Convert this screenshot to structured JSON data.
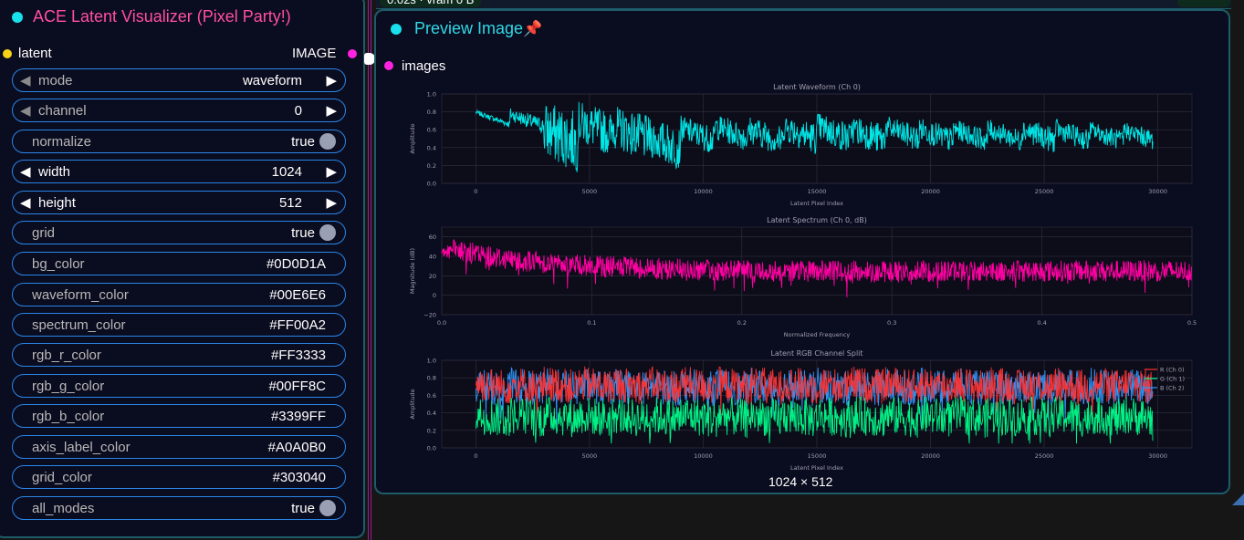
{
  "left_node": {
    "title": "ACE Latent Visualizer (Pixel Party!)",
    "input_slot": "latent",
    "output_slot": "IMAGE",
    "widgets": [
      {
        "name": "mode",
        "value": "waveform",
        "kind": "combo"
      },
      {
        "name": "channel",
        "value": "0",
        "kind": "combo"
      },
      {
        "name": "normalize",
        "value": "true",
        "kind": "toggle"
      },
      {
        "name": "width",
        "value": "1024",
        "kind": "number"
      },
      {
        "name": "height",
        "value": "512",
        "kind": "number"
      },
      {
        "name": "grid",
        "value": "true",
        "kind": "toggle"
      },
      {
        "name": "bg_color",
        "value": "#0D0D1A",
        "kind": "text"
      },
      {
        "name": "waveform_color",
        "value": "#00E6E6",
        "kind": "text"
      },
      {
        "name": "spectrum_color",
        "value": "#FF00A2",
        "kind": "text"
      },
      {
        "name": "rgb_r_color",
        "value": "#FF3333",
        "kind": "text"
      },
      {
        "name": "rgb_g_color",
        "value": "#00FF8C",
        "kind": "text"
      },
      {
        "name": "rgb_b_color",
        "value": "#3399FF",
        "kind": "text"
      },
      {
        "name": "axis_label_color",
        "value": "#A0A0B0",
        "kind": "text"
      },
      {
        "name": "grid_color",
        "value": "#303040",
        "kind": "text"
      },
      {
        "name": "all_modes",
        "value": "true",
        "kind": "toggle"
      }
    ]
  },
  "right_node": {
    "top_strip_label": "0.02s · vram 0 B",
    "title": "Preview Image",
    "pin_icon": "pushpin-icon",
    "input_slot": "images",
    "image_dims": "1024 × 512"
  },
  "colors": {
    "waveform": "#00E6E6",
    "spectrum": "#FF00A2",
    "rgb_r": "#FF3333",
    "rgb_g": "#00FF8C",
    "rgb_b": "#3399FF",
    "axis_label": "#A0A0B0",
    "grid": "#303040",
    "title_pink": "#FF4FA3",
    "node_title_cyan": "#2FD9E6"
  },
  "chart_data": [
    {
      "type": "line",
      "title": "Latent Waveform (Ch 0)",
      "xlabel": "Latent Pixel Index",
      "ylabel": "Amplitude",
      "xlim": [
        -1500,
        31500
      ],
      "ylim": [
        0.0,
        1.0
      ],
      "xticks": [
        "0",
        "5000",
        "10000",
        "15000",
        "20000",
        "25000",
        "30000"
      ],
      "yticks": [
        "0.0",
        "0.2",
        "0.4",
        "0.6",
        "0.8",
        "1.0"
      ],
      "grid": true,
      "series": [
        {
          "x_range": [
            0,
            29800
          ],
          "segment_len": 1500,
          "upper_envelope": [
            0.82,
            0.85,
            0.92,
            0.92,
            0.88,
            0.75,
            0.76,
            0.78,
            0.76,
            0.8,
            0.8,
            0.78,
            0.76,
            0.74,
            0.72,
            0.72,
            0.74,
            0.72,
            0.7,
            0.7
          ],
          "lower_envelope": [
            0.62,
            0.55,
            0.12,
            0.3,
            0.25,
            0.15,
            0.32,
            0.35,
            0.3,
            0.32,
            0.32,
            0.3,
            0.35,
            0.33,
            0.35,
            0.35,
            0.33,
            0.35,
            0.35,
            0.35
          ]
        }
      ]
    },
    {
      "type": "line",
      "title": "Latent Spectrum (Ch 0, dB)",
      "xlabel": "Normalized Frequency",
      "ylabel": "Magnitude (dB)",
      "xlim": [
        0.0,
        0.5
      ],
      "ylim": [
        -20,
        70
      ],
      "xticks": [
        "0.0",
        "0.1",
        "0.2",
        "0.3",
        "0.4",
        "0.5"
      ],
      "yticks": [
        "−20",
        "0",
        "20",
        "40",
        "60"
      ],
      "grid": true,
      "series": [
        {
          "x": [
            0.0,
            0.05,
            0.1,
            0.15,
            0.2,
            0.25,
            0.3,
            0.35,
            0.4,
            0.45,
            0.5
          ],
          "values": [
            48,
            36,
            30,
            27,
            25,
            25,
            24,
            25,
            25,
            25,
            25
          ]
        }
      ]
    },
    {
      "type": "line",
      "title": "Latent RGB Channel Split",
      "xlabel": "Latent Pixel Index",
      "ylabel": "Amplitude",
      "xlim": [
        -1500,
        31500
      ],
      "ylim": [
        0.0,
        1.0
      ],
      "xticks": [
        "0",
        "5000",
        "10000",
        "15000",
        "20000",
        "25000",
        "30000"
      ],
      "yticks": [
        "0.0",
        "0.2",
        "0.4",
        "0.6",
        "0.8",
        "1.0"
      ],
      "grid": true,
      "legend": "top-right",
      "series": [
        {
          "name": "R (Ch 0)",
          "color": "#FF3333",
          "level": 0.74
        },
        {
          "name": "G (Ch 1)",
          "color": "#00FF8C",
          "level": 0.38
        },
        {
          "name": "B (Ch 2)",
          "color": "#3399FF",
          "level": 0.72
        }
      ]
    }
  ]
}
